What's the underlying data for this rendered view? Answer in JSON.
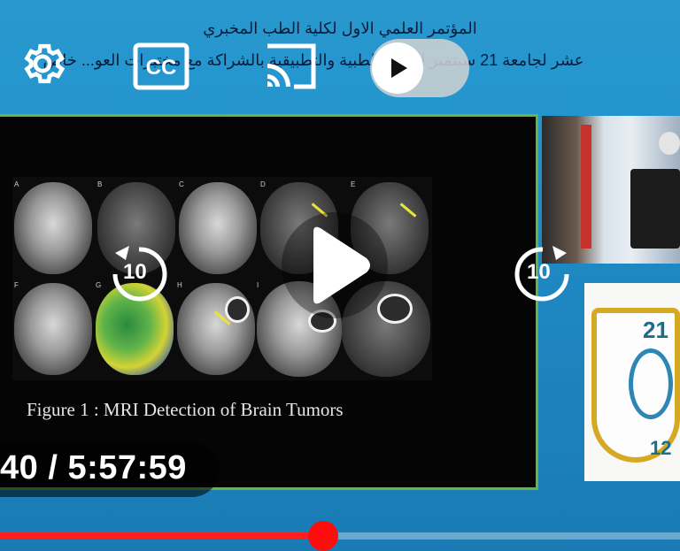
{
  "header": {
    "line1": "المؤتمر العلمي الاول لكلية الطب المخبري",
    "line2": "عشر لجامعة 21 سبتمبر للعلوم الطبية والتطبيقية بالشراكة مع مختبرات العو... خاص"
  },
  "slide": {
    "caption": "Figure 1 : MRI Detection of Brain Tumors",
    "panel_letters": [
      "A",
      "B",
      "C",
      "D",
      "E",
      "F",
      "G",
      "H",
      "I"
    ]
  },
  "logo": {
    "top_number": "21",
    "bottom_number": "12"
  },
  "player": {
    "settings_icon": "gear-icon",
    "captions_icon": "cc-icon",
    "cast_icon": "cast-icon",
    "autoplay_icon": "play-icon",
    "center_play_icon": "play-icon",
    "seek_back_label": "10",
    "seek_forward_label": "10",
    "time_display": "40 / 5:57:59",
    "progress": 0.475,
    "progress_color": "#ff1f1f"
  }
}
